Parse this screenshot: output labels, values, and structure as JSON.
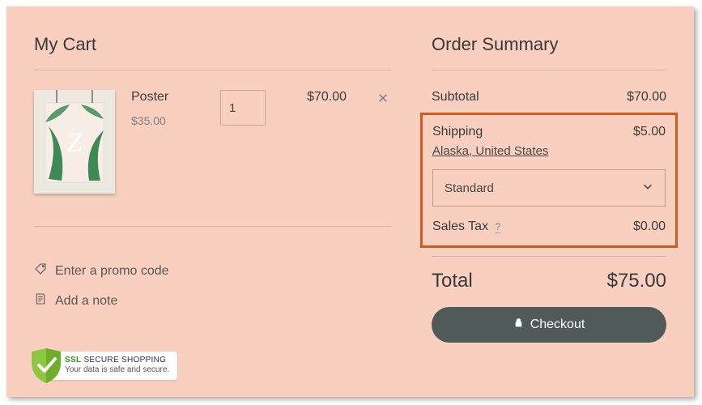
{
  "cart": {
    "title": "My Cart",
    "item": {
      "name": "Poster",
      "unit_price": "$35.00",
      "qty": "1",
      "line_total": "$70.00"
    },
    "promo_link": "Enter a promo code",
    "note_link": "Add a note"
  },
  "summary": {
    "title": "Order Summary",
    "subtotal_label": "Subtotal",
    "subtotal_value": "$70.00",
    "shipping_label": "Shipping",
    "shipping_value": "$5.00",
    "destination": "Alaska, United States",
    "shipping_method": "Standard",
    "tax_label": "Sales Tax",
    "tax_help": "?",
    "tax_value": "$0.00",
    "total_label": "Total",
    "total_value": "$75.00",
    "checkout_label": "Checkout"
  },
  "ssl": {
    "line1_prefix": "SSL",
    "line1_rest": "SECURE SHOPPING",
    "line2": "Your data is safe and secure."
  }
}
